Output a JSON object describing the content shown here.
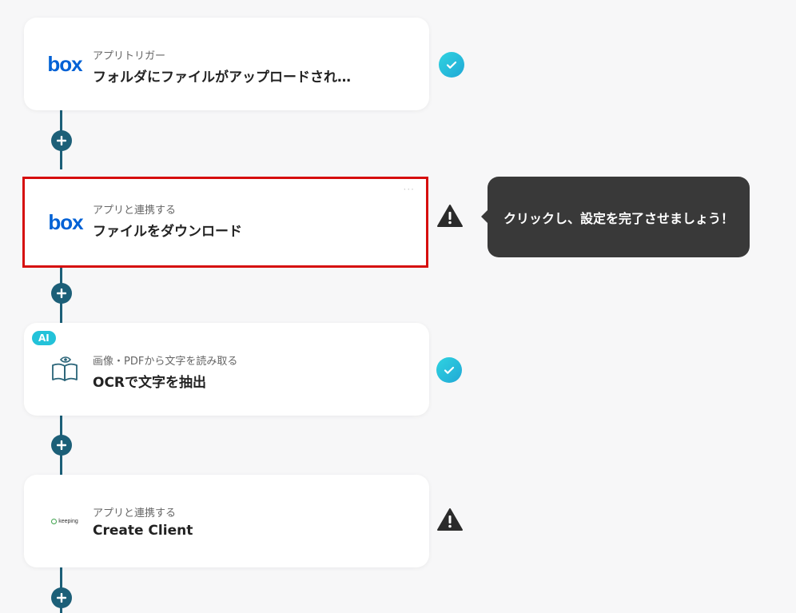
{
  "steps": [
    {
      "subtitle": "アプリトリガー",
      "title": "フォルダにファイルがアップロードされ…",
      "logo": "box",
      "status": "complete"
    },
    {
      "subtitle": "アプリと連携する",
      "title": "ファイルをダウンロード",
      "logo": "box",
      "status": "warning",
      "selected": true
    },
    {
      "subtitle": "画像・PDFから文字を読み取る",
      "title": "OCRで文字を抽出",
      "logo": "book-eye-icon",
      "badge": "AI",
      "status": "complete"
    },
    {
      "subtitle": "アプリと連携する",
      "title": "Create Client",
      "logo": "keeping",
      "status": "warning"
    }
  ],
  "logos": {
    "box": "box",
    "keeping": "keeping"
  },
  "tooltip": {
    "text": "クリックし、設定を完了させましょう！"
  },
  "more_menu": {
    "label": "···"
  },
  "colors": {
    "connector": "#1c5f78",
    "check": "#21a8d6",
    "selection_border": "#d60e0e",
    "tooltip_bg": "#393939",
    "box_brand": "#0061d5"
  }
}
